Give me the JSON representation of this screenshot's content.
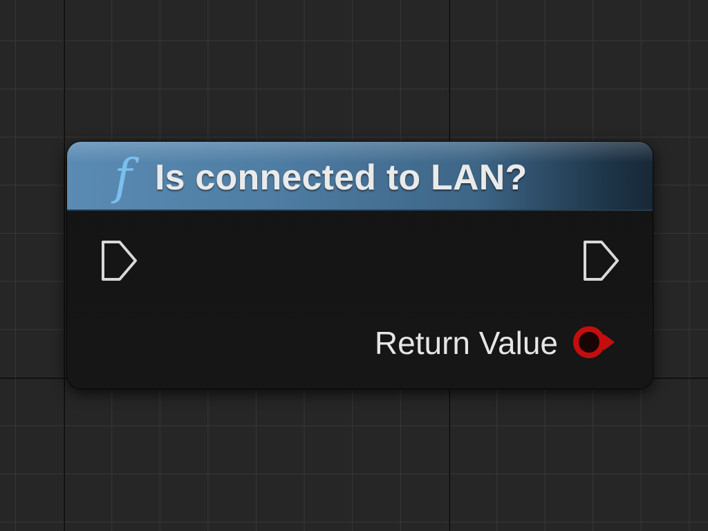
{
  "node": {
    "title": "Is connected to LAN?",
    "icon": "function-icon",
    "icon_glyph": "f",
    "header_color": "#4f7da3",
    "icon_color": "#79bfef",
    "exec_in_icon": "exec-pin-icon",
    "exec_out_icon": "exec-pin-icon",
    "outputs": [
      {
        "label": "Return Value",
        "type": "bool",
        "pin_color": "#c40e0e",
        "icon": "bool-pin-icon"
      }
    ]
  }
}
